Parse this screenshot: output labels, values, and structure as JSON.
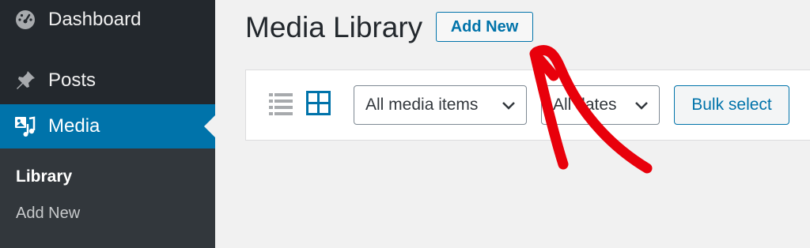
{
  "sidebar": {
    "items": [
      {
        "label": "Dashboard",
        "icon": "dashboard-icon"
      },
      {
        "label": "Posts",
        "icon": "pin-icon"
      },
      {
        "label": "Media",
        "icon": "media-icon"
      }
    ],
    "submenu": {
      "library": "Library",
      "add_new": "Add New"
    }
  },
  "header": {
    "title": "Media Library",
    "add_new_label": "Add New"
  },
  "toolbar": {
    "media_filter": "All media items",
    "dates_filter": "All dates",
    "bulk_select_label": "Bulk select"
  },
  "colors": {
    "sidebar_bg": "#23282d",
    "submenu_bg": "#32373c",
    "accent": "#0073aa",
    "annotation": "#e8000b"
  }
}
